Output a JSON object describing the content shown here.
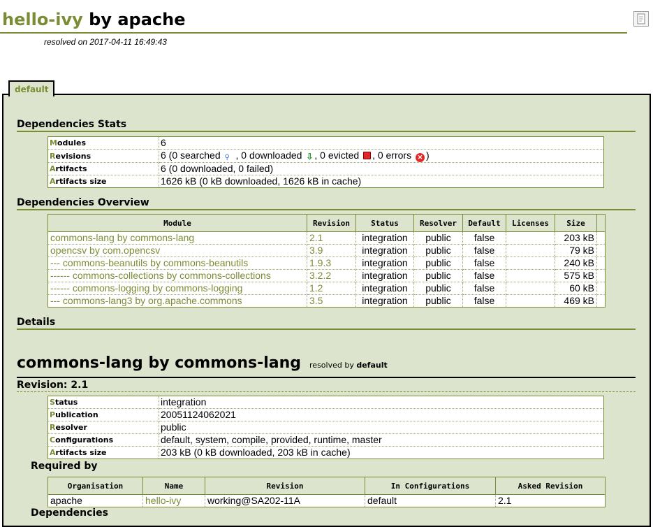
{
  "header": {
    "project_name": "hello-ivy",
    "by_text": " by apache",
    "resolved_on": "resolved on 2017-04-11 16:49:43"
  },
  "tab": {
    "label": "default"
  },
  "stats": {
    "title": "Dependencies Stats",
    "rows": [
      {
        "first": "M",
        "rest": "odules",
        "value": "6"
      },
      {
        "first": "R",
        "rest": "evisions",
        "value_parts": [
          "6 (0 searched ",
          ", 0 downloaded ",
          ", 0 evicted ",
          ", 0 errors ",
          ")"
        ]
      },
      {
        "first": "A",
        "rest": "rtifacts",
        "value": "6 (0 downloaded, 0 failed)"
      },
      {
        "first": "A",
        "rest": "rtifacts size",
        "value": "1626 kB (0 kB downloaded, 1626 kB in cache)"
      }
    ]
  },
  "overview": {
    "title": "Dependencies Overview",
    "columns": [
      "Module",
      "Revision",
      "Status",
      "Resolver",
      "Default",
      "Licenses",
      "Size"
    ],
    "rows": [
      {
        "module": "commons-lang by commons-lang",
        "revision": "2.1",
        "status": "integration",
        "resolver": "public",
        "default": "false",
        "licenses": "",
        "size": "203 kB"
      },
      {
        "module": "opencsv by com.opencsv",
        "revision": "3.9",
        "status": "integration",
        "resolver": "public",
        "default": "false",
        "licenses": "",
        "size": "79 kB"
      },
      {
        "module": "--- commons-beanutils by commons-beanutils",
        "revision": "1.9.3",
        "status": "integration",
        "resolver": "public",
        "default": "false",
        "licenses": "",
        "size": "240 kB"
      },
      {
        "module": "------ commons-collections by commons-collections",
        "revision": "3.2.2",
        "status": "integration",
        "resolver": "public",
        "default": "false",
        "licenses": "",
        "size": "575 kB"
      },
      {
        "module": "------ commons-logging by commons-logging",
        "revision": "1.2",
        "status": "integration",
        "resolver": "public",
        "default": "false",
        "licenses": "",
        "size": "60 kB"
      },
      {
        "module": "--- commons-lang3 by org.apache.commons",
        "revision": "3.5",
        "status": "integration",
        "resolver": "public",
        "default": "false",
        "licenses": "",
        "size": "469 kB"
      }
    ]
  },
  "details": {
    "title": "Details",
    "module_title": "commons-lang by commons-lang",
    "resolved_by_prefix": "resolved by ",
    "resolved_by": "default",
    "revision_title": "Revision: 2.1",
    "info": [
      {
        "first": "S",
        "rest": "tatus",
        "value": "integration"
      },
      {
        "first": "P",
        "rest": "ublication",
        "value": "20051124062021"
      },
      {
        "first": "R",
        "rest": "esolver",
        "value": "public"
      },
      {
        "first": "C",
        "rest": "onfigurations",
        "value": "default, system, compile, provided, runtime, master"
      },
      {
        "first": "A",
        "rest": "rtifacts size",
        "value": "203 kB (0 kB downloaded, 203 kB in cache)"
      }
    ],
    "required_by_title": "Required by",
    "required_by_columns": [
      "Organisation",
      "Name",
      "Revision",
      "In Configurations",
      "Asked Revision"
    ],
    "required_by_rows": [
      {
        "organisation": "apache",
        "name": "hello-ivy",
        "revision": "working@SA202-11A",
        "configurations": "default",
        "asked_revision": "2.1"
      }
    ],
    "dependencies_title": "Dependencies"
  }
}
